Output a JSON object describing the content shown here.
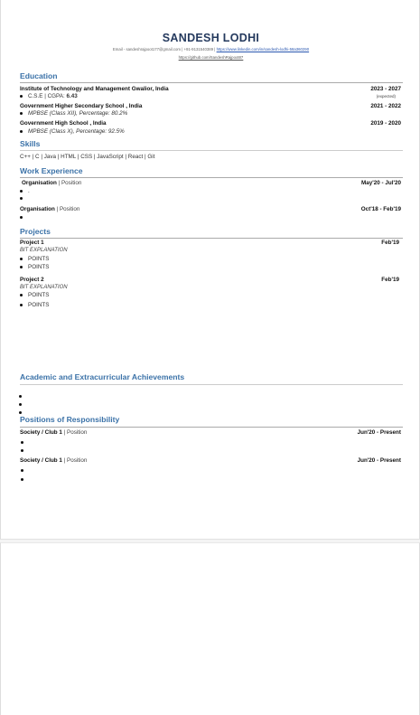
{
  "header": {
    "name": "SANDESH LODHI",
    "contact_line": "Email - sandeshrajpoot177@gmail.com | +91-9131540389 |",
    "link_1": "https://www.linkedin.com/in/sandesh-lodhi-58a360290",
    "link_2": "https://github.com/SandeshRajpoot87"
  },
  "education": {
    "heading": "Education",
    "entries": [
      {
        "school": "Institute of Technology and Management Gwalior, India",
        "detail_prefix": "C.S.E  | CGPA: ",
        "detail_value": "6.43",
        "dates": "2023 - 2027",
        "note": "(expected)"
      },
      {
        "school": "Government Higher Secondary  School , India",
        "detail": "MPBSE (Class XII), Percentage: 80.2%",
        "dates": "2021 - 2022"
      },
      {
        "school": "Government High School , India",
        "detail": "MPBSE (Class X), Percentage: 92.5%",
        "dates": "2019 - 2020"
      }
    ]
  },
  "skills": {
    "heading": "Skills",
    "text": "C++ | C | Java | HTML  | CSS  | JavaScript | React  | Git"
  },
  "work": {
    "heading": "Work Experience",
    "entries": [
      {
        "org": "Organisation",
        "sep": " | ",
        "position": "Position",
        "dates": "May'20 - Jul'20",
        "bullet1": "."
      },
      {
        "org": "Organisation",
        "sep": " | ",
        "position": "Position",
        "dates": "Oct'18 - Feb'19"
      }
    ]
  },
  "projects": {
    "heading": "Projects",
    "entries": [
      {
        "title": "Project 1",
        "explanation": "BIT EXPLANATION",
        "points": [
          "POINTS",
          "POINTS"
        ],
        "date": "Feb'19"
      },
      {
        "title": "Project 2",
        "explanation": "BIT EXPLANATION",
        "points": [
          "POINTS",
          "POINTS"
        ],
        "date": "Feb'19"
      }
    ]
  },
  "achievements": {
    "heading": "Academic and Extracurricular Achievements"
  },
  "responsibility": {
    "heading": "Positions of Responsibility",
    "entries": [
      {
        "org": "Society / Club 1",
        "sep": " | ",
        "position": "Position",
        "dates": "Jun'20 - Present"
      },
      {
        "org": "Society / Club 1",
        "sep": " | ",
        "position": "Position",
        "dates": "Jun'20 - Present"
      }
    ]
  }
}
